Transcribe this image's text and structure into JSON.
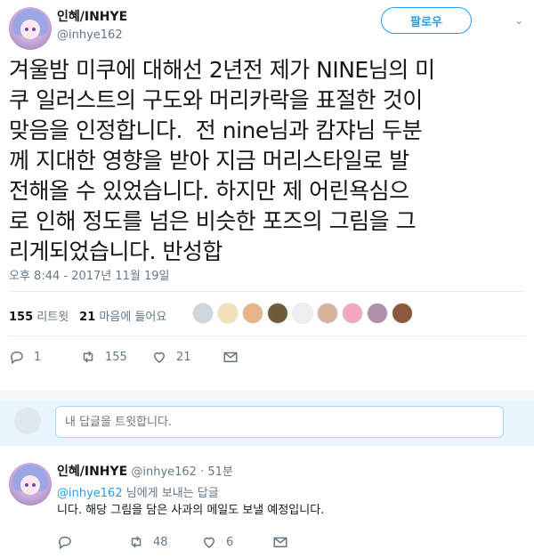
{
  "tweet": {
    "display_name": "인혜/INHYE",
    "handle": "@inhye162",
    "follow_label": "팔로우",
    "text": "겨울밤 미쿠에 대해선 2년전 제가 NINE님의 미\n쿠 일러스트의 구도와 머리카락을 표절한 것이\n맞음을 인정합니다.  전 nine님과 캄쟈님 두분\n께 지대한 영향을 받아 지금 머리스타일로 발\n전해올 수 있었습니다. 하지만 제 어린욕심으\n로 인해 정도를 넘은 비슷한 포즈의 그림을 그\n리게되었습니다. 반성합",
    "timestamp": "오후 8:44 - 2017년 11월 19일",
    "retweets_count": "155",
    "retweets_label": "리트윗",
    "likes_count": "21",
    "likes_label": "마음에 들어요",
    "actions": {
      "reply_count": "1",
      "retweet_count": "155",
      "like_count": "21"
    },
    "liker_colors": [
      "#cfd6dc",
      "#f3e2b8",
      "#e7b48a",
      "#6f5a3c",
      "#efefef",
      "#d9b2a0",
      "#f2a7c3",
      "#b08fa8",
      "#8a5a3a"
    ]
  },
  "reply_box": {
    "placeholder": "내 답글을 트윗합니다."
  },
  "reply": {
    "display_name": "인혜/INHYE",
    "handle": "@inhye162",
    "time": "· 51분",
    "to_mention": "@inhye162",
    "to_suffix": " 님에게 보내는 답글",
    "text": "니다. 해당 그림을 담은 사과의 메일도 보낼 예정입니다.",
    "actions": {
      "reply_count": "",
      "retweet_count": "48",
      "like_count": "6"
    }
  },
  "colors": {
    "accent": "#1da1f2",
    "muted": "#657786",
    "text": "#14171a"
  }
}
